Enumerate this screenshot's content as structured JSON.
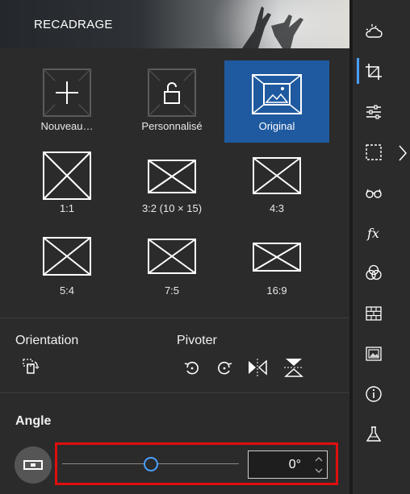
{
  "header": {
    "title": "RECADRAGE"
  },
  "aspect_tiles": [
    {
      "label": "Nouveau…",
      "icon": "plus-icon",
      "selected": false
    },
    {
      "label": "Personnalisé",
      "icon": "unlock-icon",
      "selected": false
    },
    {
      "label": "Original",
      "icon": "image-icon",
      "selected": true
    },
    {
      "label": "1:1",
      "icon": "ratio-1-1-icon",
      "selected": false
    },
    {
      "label": "3:2 (10 × 15)",
      "icon": "ratio-3-2-icon",
      "selected": false
    },
    {
      "label": "4:3",
      "icon": "ratio-4-3-icon",
      "selected": false
    },
    {
      "label": "5:4",
      "icon": "ratio-5-4-icon",
      "selected": false
    },
    {
      "label": "7:5",
      "icon": "ratio-7-5-icon",
      "selected": false
    },
    {
      "label": "16:9",
      "icon": "ratio-16-9-icon",
      "selected": false
    }
  ],
  "orientation": {
    "label": "Orientation"
  },
  "rotate": {
    "label": "Pivoter"
  },
  "angle": {
    "label": "Angle",
    "value": "0°",
    "slider_fraction": 0.5
  },
  "rail": [
    "weather-icon",
    "crop-icon",
    "adjust-sliders-icon",
    "selection-icon",
    "glasses-icon",
    "fx-icon",
    "color-circles-icon",
    "texture-icon",
    "frame-icon",
    "info-icon",
    "lab-flask-icon"
  ],
  "colors": {
    "accent": "#1f5aa0",
    "highlight": "#e00e0e",
    "slider": "#4aa0ff"
  }
}
